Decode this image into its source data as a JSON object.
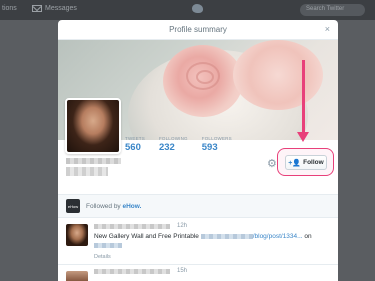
{
  "topbar": {
    "home_label": "tions",
    "messages_label": "Messages",
    "search_placeholder": "Search Twitter"
  },
  "modal": {
    "title": "Profile summary",
    "close_glyph": "×"
  },
  "profile": {
    "stats": [
      {
        "label": "TWEETS",
        "value": "560"
      },
      {
        "label": "FOLLOWING",
        "value": "232"
      },
      {
        "label": "FOLLOWERS",
        "value": "593"
      }
    ],
    "follow_label": "Follow",
    "follow_icon_glyph": "+👤",
    "gear_glyph": "⚙"
  },
  "followed_by": {
    "logo_text": "eHow",
    "prefix": "Followed by ",
    "account": "eHow."
  },
  "tweets": [
    {
      "time": "12h",
      "text_start": "New Gallery Wall and Free Printable ",
      "link_tail": "/blog/post/1334...",
      "text_end": " on",
      "details": "Details"
    },
    {
      "time": "15h"
    }
  ],
  "colors": {
    "accent_link": "#3a86c8",
    "annotation": "#e8407a"
  }
}
